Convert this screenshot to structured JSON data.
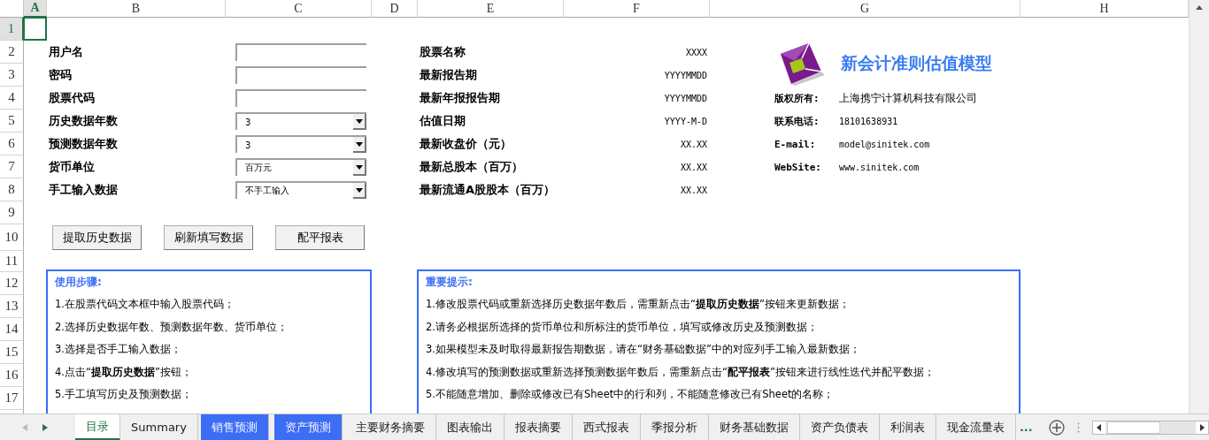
{
  "columns": [
    {
      "label": "A",
      "selected": true
    },
    {
      "label": "B",
      "selected": false
    },
    {
      "label": "C",
      "selected": false
    },
    {
      "label": "D",
      "selected": false
    },
    {
      "label": "E",
      "selected": false
    },
    {
      "label": "F",
      "selected": false
    },
    {
      "label": "G",
      "selected": false
    },
    {
      "label": "H",
      "selected": false
    }
  ],
  "rows": [
    {
      "label": "1",
      "selected": true
    },
    {
      "label": "2",
      "selected": false
    },
    {
      "label": "3",
      "selected": false
    },
    {
      "label": "4",
      "selected": false
    },
    {
      "label": "5",
      "selected": false
    },
    {
      "label": "6",
      "selected": false
    },
    {
      "label": "7",
      "selected": false
    },
    {
      "label": "8",
      "selected": false
    },
    {
      "label": "9",
      "selected": false
    },
    {
      "label": "10",
      "selected": false
    },
    {
      "label": "11",
      "selected": false
    },
    {
      "label": "12",
      "selected": false
    },
    {
      "label": "13",
      "selected": false
    },
    {
      "label": "14",
      "selected": false
    },
    {
      "label": "15",
      "selected": false
    },
    {
      "label": "16",
      "selected": false
    },
    {
      "label": "17",
      "selected": false
    }
  ],
  "form": [
    {
      "label": "用户名",
      "kind": "text"
    },
    {
      "label": "密码",
      "kind": "text"
    },
    {
      "label": "股票代码",
      "kind": "text"
    },
    {
      "label": "历史数据年数",
      "kind": "select",
      "value": "3"
    },
    {
      "label": "预测数据年数",
      "kind": "select",
      "value": "3"
    },
    {
      "label": "货币单位",
      "kind": "select",
      "value": "百万元"
    },
    {
      "label": "手工输入数据",
      "kind": "select",
      "value": "不手工输入"
    }
  ],
  "info": [
    {
      "label": "股票名称",
      "value": "XXXX"
    },
    {
      "label": "最新报告期",
      "value": "YYYYMMDD"
    },
    {
      "label": "最新年报报告期",
      "value": "YYYYMMDD"
    },
    {
      "label": "估值日期",
      "value": "YYYY-M-D"
    },
    {
      "label": "最新收盘价（元）",
      "value": "XX.XX"
    },
    {
      "label": "最新总股本（百万）",
      "value": "XX.XX"
    },
    {
      "label": "最新流通A股股本（百万）",
      "value": "XX.XX"
    }
  ],
  "product_title": "新会计准则估值模型",
  "contacts": [
    {
      "label": "版权所有:",
      "value": "上海携宁计算机科技有限公司"
    },
    {
      "label": "联系电话:",
      "value": "18101638931"
    },
    {
      "label": "E-mail:",
      "value": "model@sinitek.com"
    },
    {
      "label": "WebSite:",
      "value": "www.sinitek.com"
    }
  ],
  "buttons": [
    "提取历史数据",
    "刷新填写数据",
    "配平报表"
  ],
  "steps": {
    "title": "使用步骤:",
    "lines": [
      "1.在股票代码文本框中输入股票代码；",
      "2.选择历史数据年数、预测数据年数、货币单位；",
      "3.选择是否手工输入数据；",
      "4.点击“**提取历史数据**”按钮；",
      "5.手工填写历史及预测数据；"
    ]
  },
  "notes": {
    "title": "重要提示:",
    "lines": [
      "1.修改股票代码或重新选择历史数据年数后，需重新点击“**提取历史数据**”按钮来更新数据；",
      "2.请务必根据所选择的货币单位和所标注的货币单位，填写或修改历史及预测数据；",
      "3.如果模型未及时取得最新报告期数据，请在“财务基础数据”中的对应列手工输入最新数据；",
      "4.修改填写的预测数据或重新选择预测数据年数后，需重新点击“**配平报表**”按钮来进行线性迭代并配平数据；",
      "5.不能随意增加、删除或修改已有Sheet中的行和列，不能随意修改已有Sheet的名称；"
    ]
  },
  "sheet_tabs": [
    {
      "label": "目录",
      "selected": true
    },
    {
      "label": "Summary",
      "selected": false
    },
    {
      "label": "销售预测",
      "selected": false,
      "color": "#3d6df5"
    },
    {
      "label": "资产预测",
      "selected": false,
      "color": "#3d6df5"
    },
    {
      "label": "主要财务摘要",
      "selected": false
    },
    {
      "label": "图表输出",
      "selected": false
    },
    {
      "label": "报表摘要",
      "selected": false
    },
    {
      "label": "西式报表",
      "selected": false
    },
    {
      "label": "季报分析",
      "selected": false
    },
    {
      "label": "财务基础数据",
      "selected": false
    },
    {
      "label": "资产负债表",
      "selected": false
    },
    {
      "label": "利润表",
      "selected": false
    },
    {
      "label": "现金流量表",
      "selected": false
    }
  ],
  "more_tabs": "..."
}
